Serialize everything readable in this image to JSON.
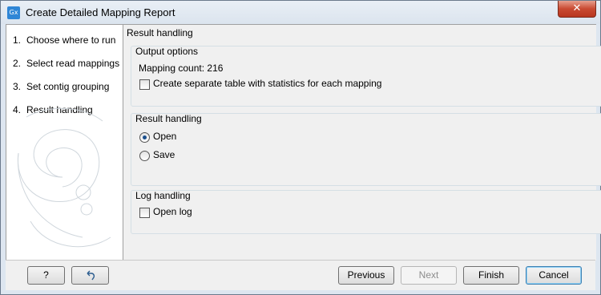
{
  "window": {
    "title": "Create Detailed Mapping Report",
    "app_icon_text": "Gx"
  },
  "steps": [
    {
      "num": "1.",
      "label": "Choose where to run"
    },
    {
      "num": "2.",
      "label": "Select read mappings"
    },
    {
      "num": "3.",
      "label": "Set contig grouping"
    },
    {
      "num": "4.",
      "label": "Result handling"
    }
  ],
  "main": {
    "header": "Result handling",
    "output_options": {
      "title": "Output options",
      "mapping_count": "Mapping count: 216",
      "separate_table_label": "Create separate table with statistics for each mapping",
      "separate_table_checked": false
    },
    "result_handling": {
      "title": "Result handling",
      "options": [
        "Open",
        "Save"
      ],
      "selected": "Open"
    },
    "log_handling": {
      "title": "Log handling",
      "open_log_label": "Open log",
      "open_log_checked": false
    }
  },
  "buttons": {
    "help": "?",
    "previous": "Previous",
    "next": "Next",
    "finish": "Finish",
    "cancel": "Cancel"
  }
}
